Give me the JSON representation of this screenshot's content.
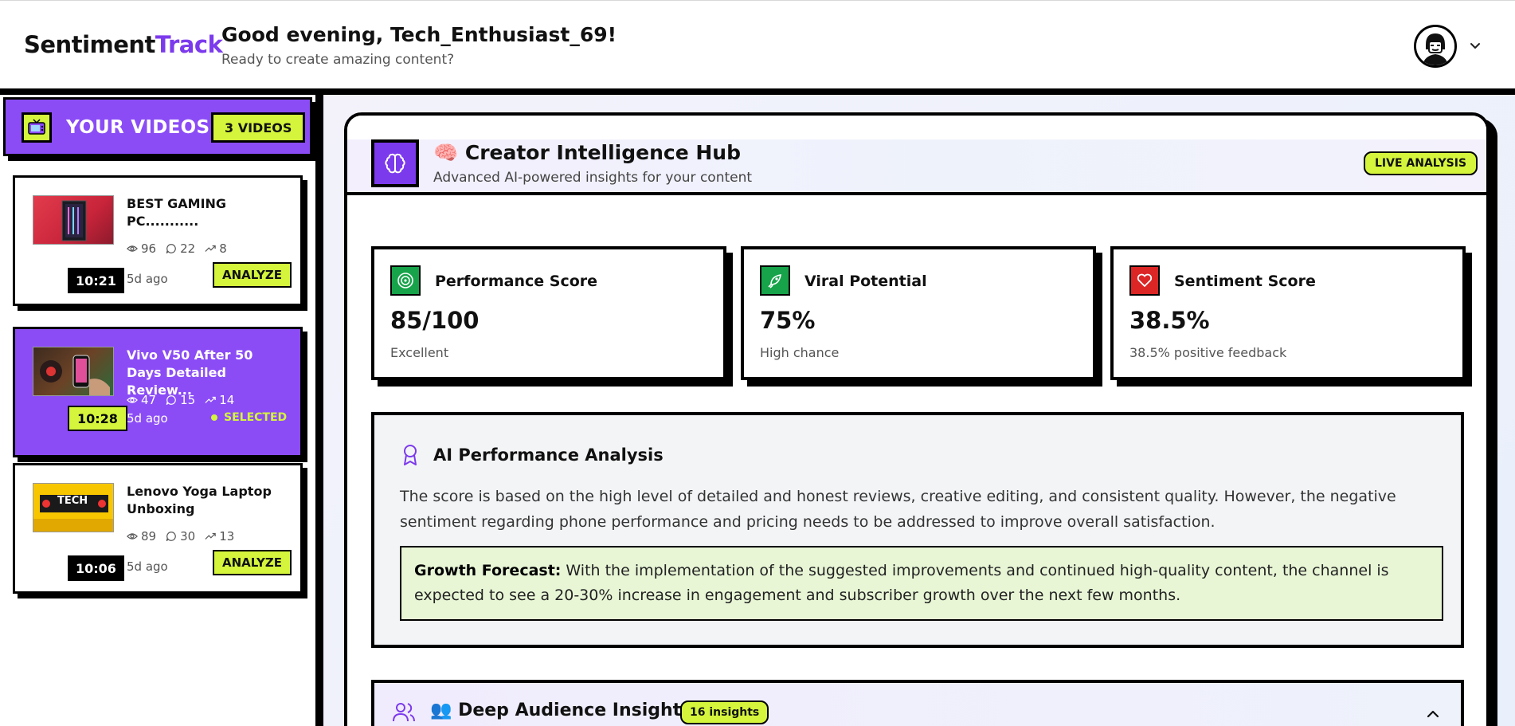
{
  "header": {
    "logo_main": "Sentiment",
    "logo_accent": "Track",
    "greeting": "Good evening, Tech_Enthusiast_69!",
    "subtitle": "Ready to create amazing content?"
  },
  "sidebar": {
    "title": "YOUR VIDEOS",
    "count_badge": "3 VIDEOS",
    "videos": [
      {
        "title": "BEST GAMING PC...........",
        "views": "96",
        "comments": "22",
        "trend": "8",
        "duration": "10:21",
        "age": "5d ago",
        "action": "ANALYZE",
        "selected": false
      },
      {
        "title": "Vivo V50 After 50 Days Detailed Review...",
        "views": "47",
        "comments": "15",
        "trend": "14",
        "duration": "10:28",
        "age": "5d ago",
        "action": "SELECTED",
        "selected": true
      },
      {
        "title": "Lenovo Yoga Laptop Unboxing",
        "views": "89",
        "comments": "30",
        "trend": "13",
        "duration": "10:06",
        "age": "5d ago",
        "action": "ANALYZE",
        "selected": false
      }
    ],
    "thumb_text_3": "TECH"
  },
  "hub": {
    "emoji": "🧠",
    "title": "Creator Intelligence Hub",
    "subtitle": "Advanced AI-powered insights for your content",
    "live_badge": "LIVE ANALYSIS"
  },
  "metrics": [
    {
      "label": "Performance Score",
      "value": "85/100",
      "sub": "Excellent",
      "icon": "target-icon",
      "color": "#16a34a"
    },
    {
      "label": "Viral Potential",
      "value": "75%",
      "sub": "High chance",
      "icon": "rocket-icon",
      "color": "#16a34a"
    },
    {
      "label": "Sentiment Score",
      "value": "38.5%",
      "sub": "38.5% positive feedback",
      "icon": "heart-icon",
      "color": "#dc2626"
    }
  ],
  "analysis": {
    "title": "AI Performance Analysis",
    "body": "The score is based on the high level of detailed and honest reviews, creative editing, and consistent quality. However, the negative sentiment regarding phone performance and pricing needs to be addressed to improve overall satisfaction.",
    "forecast_label": "Growth Forecast:",
    "forecast_text": " With the implementation of the suggested improvements and continued high-quality content, the channel is expected to see a 20-30% increase in engagement and subscriber growth over the next few months."
  },
  "deep": {
    "emoji": "👥",
    "title": "Deep Audience Insights",
    "badge": "16 insights"
  },
  "colors": {
    "accent": "#7c3aed",
    "lime": "#d4f53c",
    "purple_card": "#8b4cf6"
  }
}
